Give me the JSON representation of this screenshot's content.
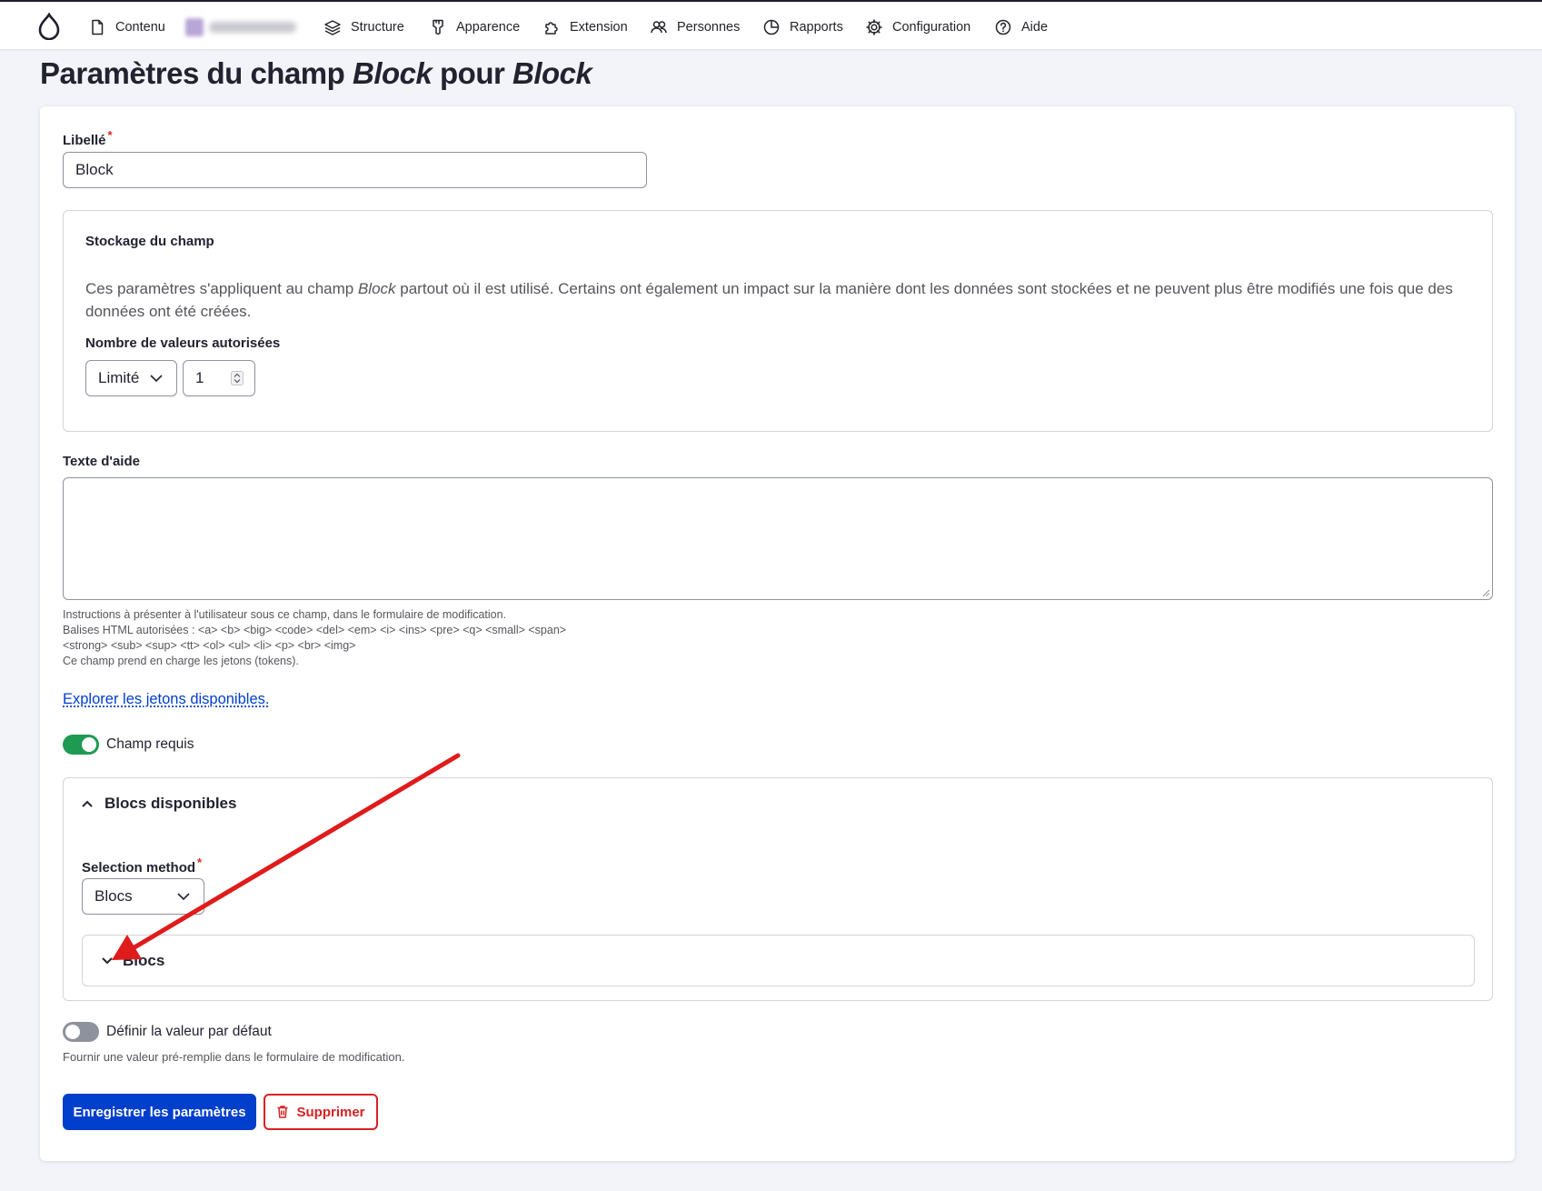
{
  "toolbar": {
    "items": [
      {
        "label": "Contenu",
        "icon": "document-icon"
      },
      {
        "label": "Structure",
        "icon": "layers-icon"
      },
      {
        "label": "Apparence",
        "icon": "brush-icon"
      },
      {
        "label": "Extension",
        "icon": "puzzle-icon"
      },
      {
        "label": "Personnes",
        "icon": "people-icon"
      },
      {
        "label": "Rapports",
        "icon": "pie-chart-icon"
      },
      {
        "label": "Configuration",
        "icon": "gear-icon"
      },
      {
        "label": "Aide",
        "icon": "help-icon"
      }
    ]
  },
  "page": {
    "title_prefix": "Paramètres du champ ",
    "title_field": "Block",
    "title_mid": " pour ",
    "title_bundle": "Block"
  },
  "form": {
    "label": {
      "title": "Libellé",
      "value": "Block"
    },
    "storage": {
      "title": "Stockage du champ",
      "desc_before": "Ces paramètres s'appliquent au champ ",
      "desc_field": "Block",
      "desc_after": " partout où il est utilisé. Certains ont également un impact sur la manière dont les données sont stockées et ne peuvent plus être modifiés une fois que des données ont été créées.",
      "cardinality_label": "Nombre de valeurs autorisées",
      "cardinality_select": "Limité",
      "cardinality_number": "1"
    },
    "help": {
      "title": "Texte d'aide",
      "value": "",
      "desc_line1": "Instructions à présenter à l'utilisateur sous ce champ, dans le formulaire de modification.",
      "desc_line2": "Balises HTML autorisées : <a> <b> <big> <code> <del> <em> <i> <ins> <pre> <q> <small> <span>",
      "desc_line3": "<strong> <sub> <sup> <tt> <ol> <ul> <li> <p> <br> <img>",
      "desc_line4": "Ce champ prend en charge les jetons (tokens).",
      "tokens_link": "Explorer les jetons disponibles."
    },
    "required": {
      "label": "Champ requis",
      "checked": true
    },
    "blocks": {
      "title": "Blocs disponibles",
      "selection_label": "Selection method",
      "selection_value": "Blocs",
      "details_title": "Blocs"
    },
    "default_value": {
      "label": "Définir la valeur par défaut",
      "checked": false,
      "desc": "Fournir une valeur pré-remplie dans le formulaire de modification."
    },
    "actions": {
      "save": "Enregistrer les paramètres",
      "delete": "Supprimer"
    }
  },
  "colors": {
    "primary": "#003ecc",
    "danger": "#d72222",
    "toggle_on": "#1f9a53",
    "toggle_off": "#8e929c",
    "annotation_arrow": "#e01b1b"
  }
}
